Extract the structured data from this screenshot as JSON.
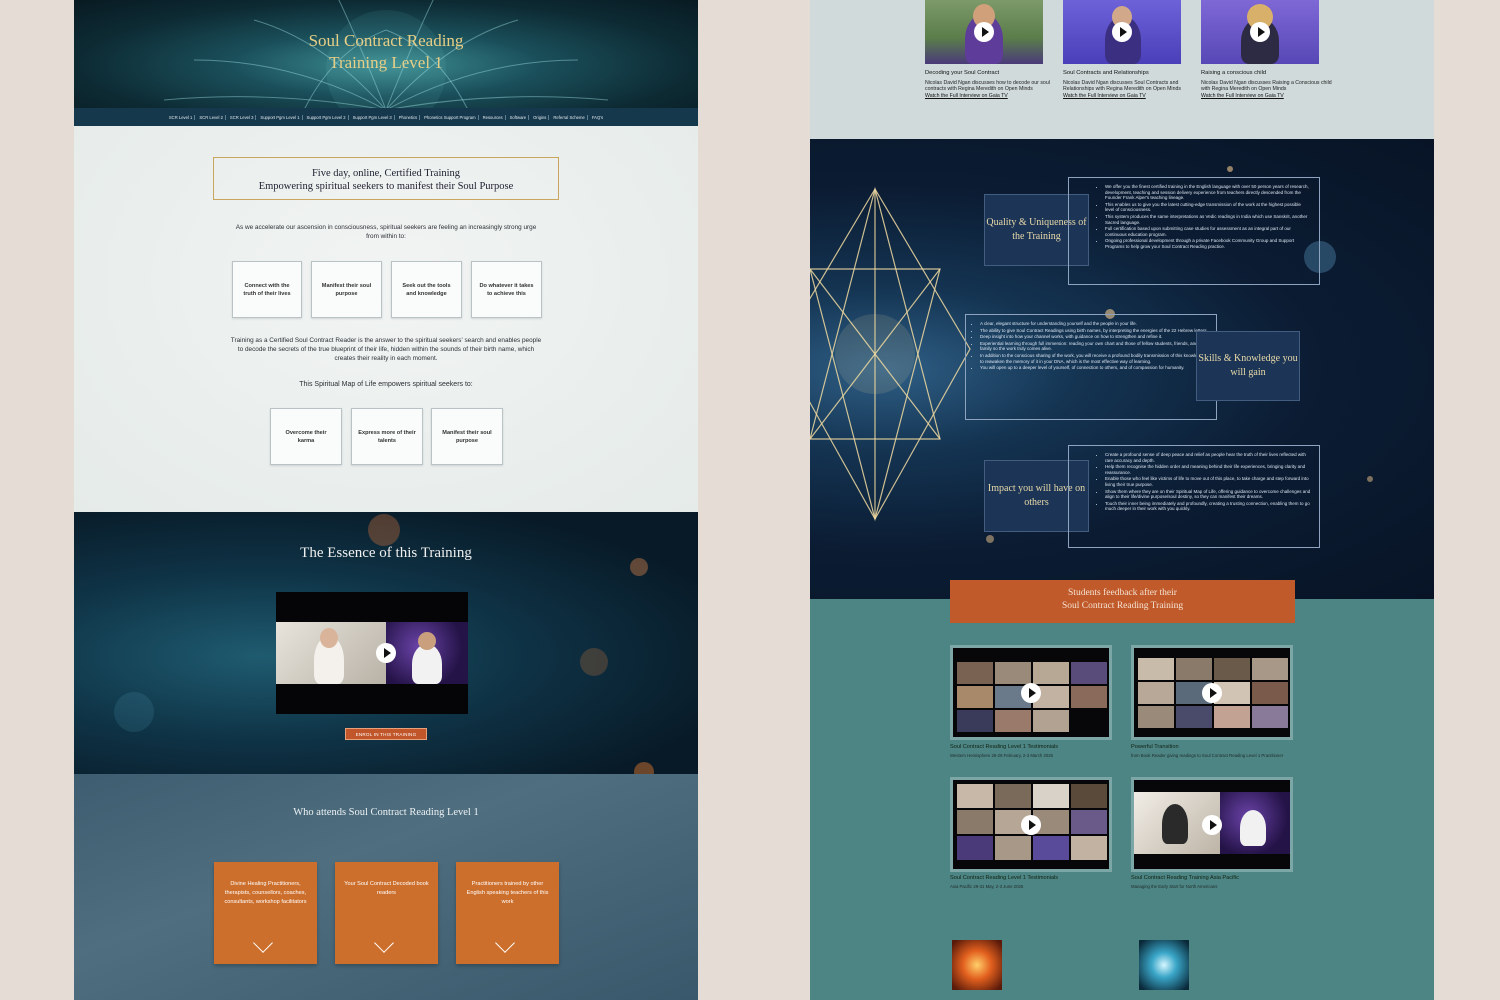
{
  "left": {
    "hero_title": [
      "Soul Contract Reading",
      "Training Level 1"
    ],
    "nav": [
      "SCR Level 1",
      "SCR Level 2",
      "SCR Level 3",
      "Support Pgm Level 1",
      "Support Pgm Level 2",
      "Support Pgm Level 3",
      "Phonetics",
      "Phonetics Support Program",
      "Resources",
      "Software",
      "Origins",
      "Referral Scheme",
      "FAQ's"
    ],
    "intro_box": [
      "Five day, online, Certified Training",
      "Empowering spiritual seekers to manifest their Soul Purpose"
    ],
    "intro_text": "As we accelerate our ascension in consciousness, spiritual seekers are feeling an increasingly strong urge from within to:",
    "cards1": [
      "Connect with the truth of their lives",
      "Manifest their soul purpose",
      "Seek out the tools and knowledge",
      "Do whatever it takes to achieve this"
    ],
    "training_text": "Training as a Certified Soul Contract Reader is the answer to the spiritual seekers' search and enables people to decode the secrets of the true blueprint of their life, hidden within the sounds of their birth name, which creates their reality in each moment.",
    "map_text": "This Spiritual Map of Life empowers spiritual seekers to:",
    "cards2": [
      "Overcome their karma",
      "Express more of their talents",
      "Manifest their soul purpose"
    ],
    "essence_title": "The Essence of this Training",
    "enrol_button": "ENROL IN THIS TRAINING",
    "attends_title": "Who attends Soul Contract Reading Level 1",
    "attend_cards": [
      "Divine Healing Practitioners, therapists, counsellors, coaches, consultants, workshop facilitators",
      "Your Soul Contract Decoded book readers",
      "Practitioners trained by other English speaking teachers of this work"
    ]
  },
  "right": {
    "videos": [
      {
        "title": "Decoding your Soul Contract",
        "desc": "Nicolas David Ngan discusses how to decode our soul contracts with Regina Meredith on Open Minds",
        "link": "Watch the Full Interview on Gaia TV"
      },
      {
        "title": "Soul Contracts and Relationships",
        "desc": "Nicolas David Ngan discusses Soul Contracts and Relationships with Regina Meredith on Open Minds",
        "link": "Watch the Full Interview on Gaia TV"
      },
      {
        "title": "Raising a conscious child",
        "desc": "Nicolas David Ngan discusses Raising a Conscious child with Regina Meredith on Open Minds",
        "link": "Watch the Full Interview on Gaia TV"
      }
    ],
    "quality_title": "Quality & Uniqueness of the Training",
    "quality_items": [
      "We offer you the finest certified training in the English language with over 50 person years of research, development, teaching and session delivery experience from teachers directly descended from the Founder Frank Alper's teaching lineage.",
      "This enables us to give you the latest cutting-edge transmission of the work at the highest possible level of consciousness.",
      "This system produces the same interpretations as Vedic readings in India which use Sanskrit, another Sacred language.",
      "Full certification based upon submitting case studies for assessment as an integral part of our continuous education program.",
      "Ongoing professional development through a private Facebook Community Group and Support Programs to help grow your Soul Contract Reading practice."
    ],
    "skills_title": "Skills & Knowledge you will gain",
    "skills_items": [
      "A clear, elegant structure for understanding yourself and the people in your life.",
      "The ability to give Soul Contract Readings using birth names, by interpreting the energies of the 22 Hebrew letters.",
      "Deep insight into how your channel works, with guidance on how to strengthen and refine it.",
      "Experiential learning through full immersion: reading your own chart and those of fellow students, friends, and family so the work truly comes alive.",
      "In addition to the conscious sharing of the work, you will receive a profound bodily transmission of this knowledge to reawaken the memory of it in your DNA, which is the most effective way of learning.",
      "You will open up to a deeper level of yourself, of connection to others, and of compassion for humanity."
    ],
    "impact_title": "Impact you will have on others",
    "impact_items": [
      "Create a profound sense of deep peace and relief as people hear the truth of their lives reflected with rare accuracy and depth.",
      "Help them recognise the hidden order and meaning behind their life experiences, bringing clarity and reassurance.",
      "Enable those who feel like victims of life to move out of this place, to take charge and step forward into living their true purpose.",
      "Show them where they are on their Spiritual Map of Life, offering guidance to overcome challenges and align to their life/divine purpose/soul destiny, so they can manifest their dreams.",
      "Touch their inner being immediately and profoundly, creating a trusting connection, enabling them to go much deeper in their work with you quickly."
    ],
    "feedback_title": [
      "Students feedback after their",
      "Soul Contract Reading Training"
    ],
    "testimonials": [
      {
        "title": "Soul Contract Reading Level 1 Testimonials",
        "sub": "Western Hemisphere 28-28 February, 2-3 March 2025"
      },
      {
        "title": "Powerful Transition",
        "sub": "from Book Reader giving readings to Soul Contract Reading Level 1 Practitioner"
      },
      {
        "title": "Soul Contract Reading Level 1 Testimonials",
        "sub": "Asia Pacific 29-31 May, 2-3 June 2025"
      },
      {
        "title": "Soul Contract Reading Training Asia Pacific",
        "sub": "Managing the Early Start for North Americans"
      }
    ]
  },
  "colors": {
    "gold": "#e8cf86",
    "orange": "#cd6f2c",
    "navy": "#16384d",
    "teal": "#4d8584"
  }
}
